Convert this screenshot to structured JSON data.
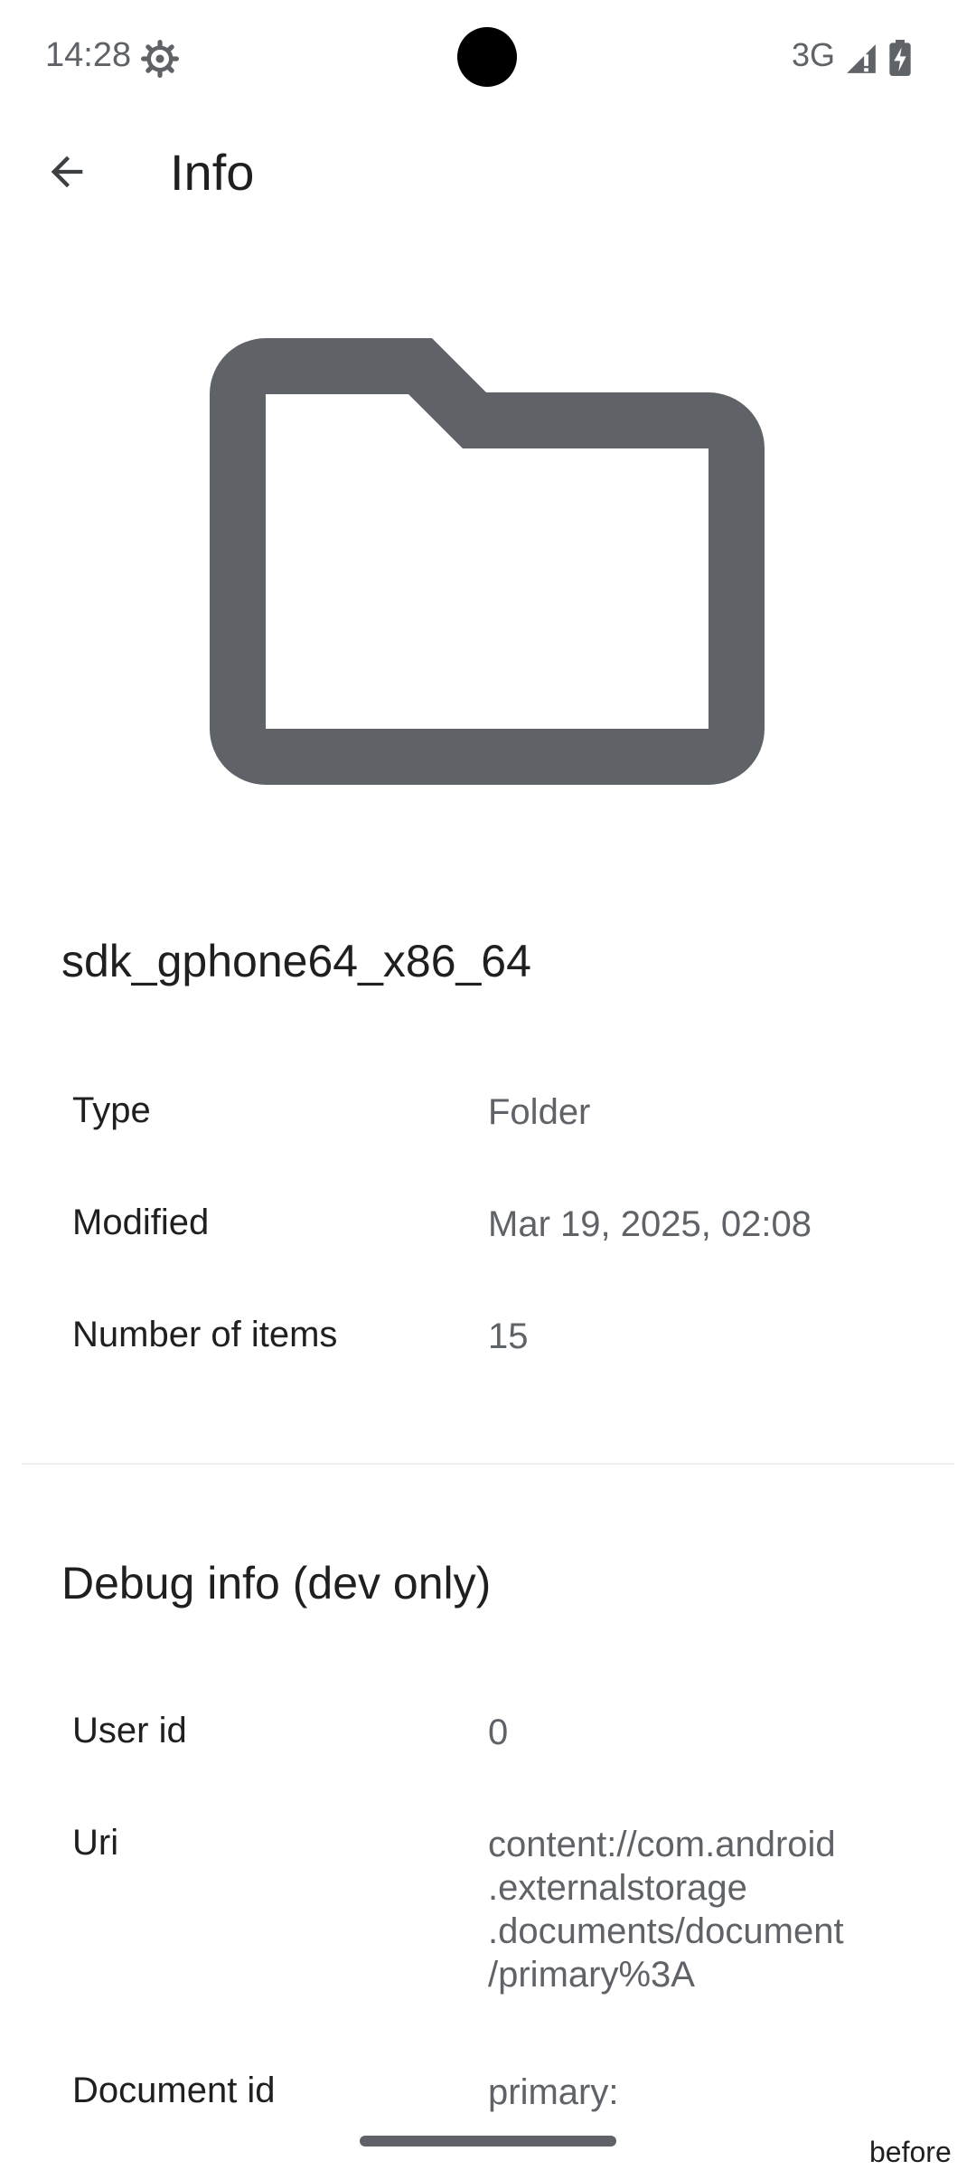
{
  "status_bar": {
    "time": "14:28",
    "network": "3G",
    "icons": [
      "settings-gear-icon",
      "signal-icon",
      "battery-charging-icon"
    ]
  },
  "app_bar": {
    "title": "Info",
    "back_icon": "arrow-back-icon"
  },
  "preview": {
    "icon": "folder-icon",
    "icon_color": "#5f6368"
  },
  "name": "sdk_gphone64_x86_64",
  "details": [
    {
      "label": "Type",
      "value": "Folder"
    },
    {
      "label": "Modified",
      "value": "Mar 19, 2025, 02:08"
    },
    {
      "label": "Number of items",
      "value": "15"
    }
  ],
  "debug": {
    "heading": "Debug info (dev only)",
    "rows": [
      {
        "label": "User id",
        "value": "0"
      },
      {
        "label": "Uri",
        "value": "content://com.android\n.externalstorage\n.documents/document\n/primary%3A"
      },
      {
        "label": "Document id",
        "value": "primary:"
      }
    ]
  },
  "footer_fragment": "before",
  "colors": {
    "text_primary": "#1f1f1f",
    "text_secondary": "#5f6368",
    "background": "#ffffff"
  }
}
